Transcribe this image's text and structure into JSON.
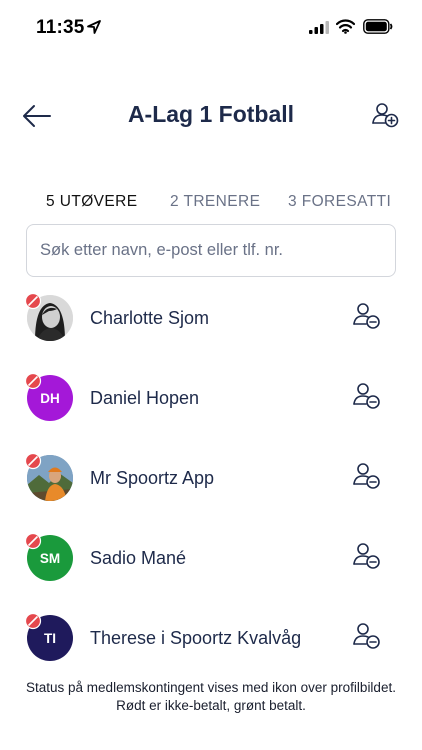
{
  "status_bar": {
    "time": "11:35",
    "icons": [
      "location-arrow-icon",
      "cellular-signal-icon",
      "wifi-icon",
      "battery-icon"
    ]
  },
  "header": {
    "title": "A-Lag 1 Fotball",
    "back_icon": "arrow-left-icon",
    "add_icon": "user-add-icon"
  },
  "tabs": [
    {
      "label": "5 UTØVERE",
      "active": true
    },
    {
      "label": "2 TRENERE",
      "active": false
    },
    {
      "label": "3 FORESATTI",
      "active": false
    }
  ],
  "search": {
    "placeholder": "Søk etter navn, e-post eller tlf. nr.",
    "value": ""
  },
  "members": [
    {
      "name": "Charlotte Sjom",
      "initials": "",
      "avatar_type": "photo",
      "payment_status": "not-paid"
    },
    {
      "name": "Daniel Hopen",
      "initials": "DH",
      "avatar_color": "#a418d8",
      "avatar_type": "initials",
      "payment_status": "not-paid"
    },
    {
      "name": "Mr Spoortz App",
      "initials": "",
      "avatar_type": "photo",
      "payment_status": "not-paid"
    },
    {
      "name": "Sadio Mané",
      "initials": "SM",
      "avatar_color": "#1a9a3c",
      "avatar_type": "initials",
      "payment_status": "not-paid"
    },
    {
      "name": "Therese i Spoortz Kvalvåg",
      "initials": "TI",
      "avatar_color": "#1f1a5c",
      "avatar_type": "initials",
      "payment_status": "not-paid"
    }
  ],
  "footnote": "Status på medlemskontingent vises med ikon over profilbildet. Rødt er ikke-betalt, grønt betalt.",
  "colors": {
    "text_primary": "#1e2a4a",
    "text_muted": "#6a7287",
    "not_paid": "#e5484d",
    "paid": "#22a447"
  }
}
